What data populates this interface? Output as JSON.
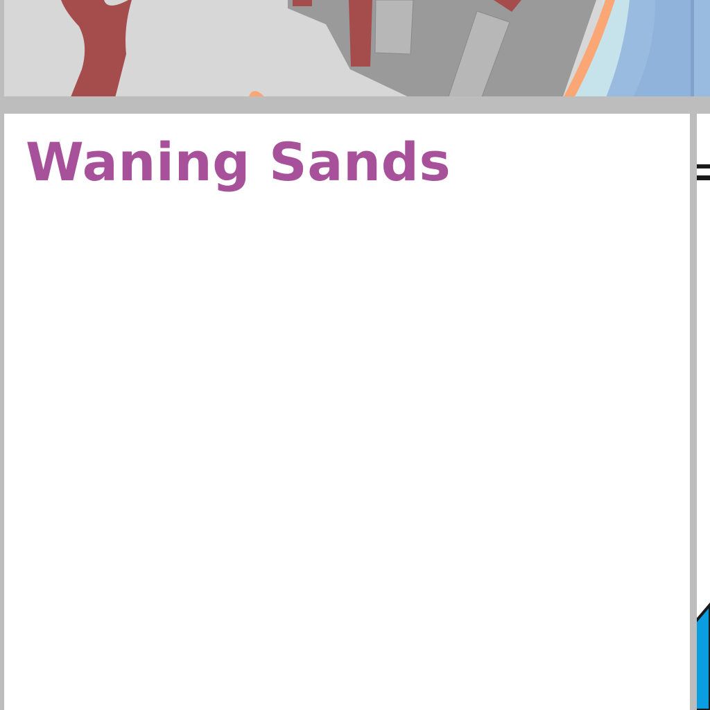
{
  "map_panel": {
    "title": "Waning Sands"
  },
  "colors": {
    "title_text": "#a8519b",
    "land": "#d7d7d7",
    "built_area": "#9a9a9a",
    "building": "#b7b7b7",
    "road": "#a54c4c",
    "beach": "#fba775",
    "shallow_water": "#c6e3ec",
    "sea": "#99bbdf",
    "sea_dark": "#7fa3cb",
    "frame": "#bdbdbd",
    "marker_fill": "#0a9ee0",
    "marker_outline": "#1a1a1a"
  },
  "icons": {
    "edge_marker": "blue-triangle-marker-icon",
    "edge_tick": "double-dash-tick-icon"
  }
}
